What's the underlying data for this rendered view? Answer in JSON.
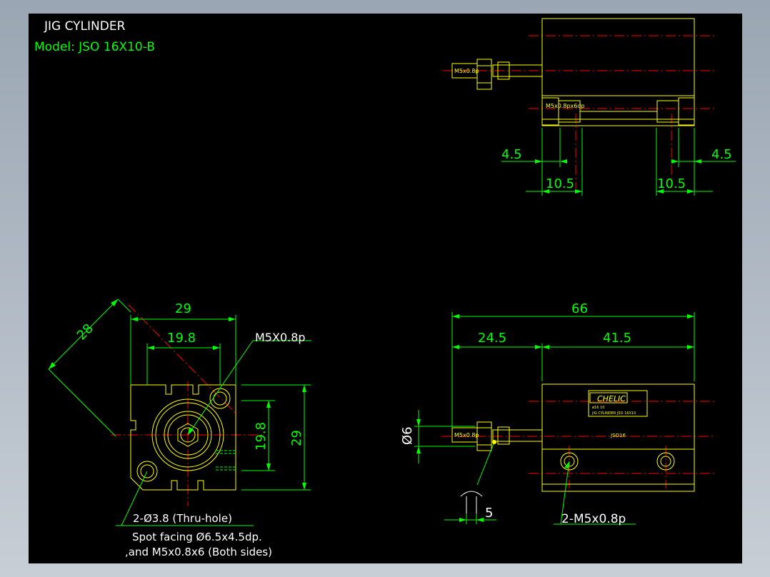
{
  "title": "JIG CYLINDER",
  "model": "Model:  JSO 16X10-B",
  "colors": {
    "background": "#000000",
    "outline": "#ffff00",
    "dimension": "#00ff00",
    "centerline": "#ff0000",
    "text": "#ffffff"
  },
  "top_view": {
    "port_label_left": "M5x0.8p",
    "port_label_bottom": "M5x0.8px6dp",
    "dim_left_small": "4.5",
    "dim_left_large": "10.5",
    "dim_right_large": "10.5",
    "dim_right_small": "4.5"
  },
  "front_view": {
    "dim_diagonal": "28",
    "dim_width_outer": "29",
    "dim_width_inner": "19.8",
    "dim_height_inner": "19.8",
    "dim_height_outer": "29",
    "thread_label": "M5X0.8p",
    "note_line1": "2-Ø3.8 (Thru-hole)",
    "note_line2": "Spot facing Ø6.5x4.5dp.",
    "note_line3": ",and M5x0.8x6 (Both sides)"
  },
  "side_view": {
    "dim_total": "66",
    "dim_left": "24.5",
    "dim_right": "41.5",
    "dim_rod_dia": "Ø6",
    "dim_wrench": "5",
    "port_label": "M5x0.8p",
    "brand": "CHELIC",
    "label_line1": "ø16 10",
    "label_line2": "JIG CYLINDER JSO 16X10",
    "model_code": "JSO16",
    "port_note": "2-M5x0.8p"
  }
}
